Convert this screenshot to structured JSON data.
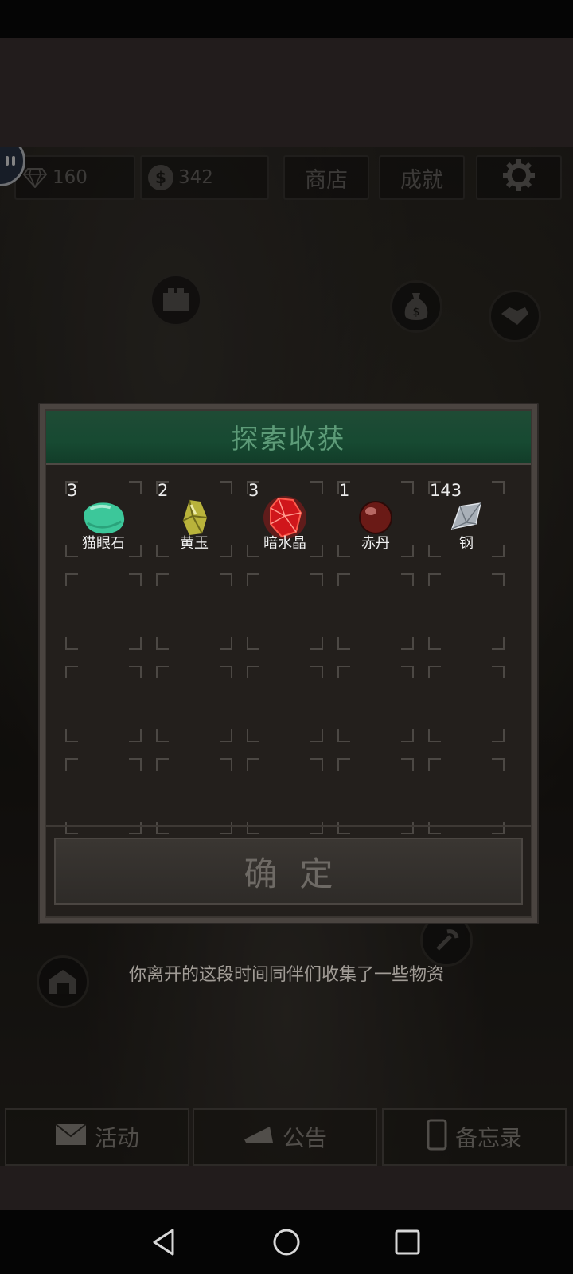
{
  "hud": {
    "gems": "160",
    "coins": "342",
    "coin_symbol": "$",
    "shop_label": "商店",
    "achievements_label": "成就"
  },
  "hint_text": "你离开的这段时间同伴们收集了一些物资",
  "tabs": [
    {
      "label": "活动",
      "icon": "mail-icon"
    },
    {
      "label": "公告",
      "icon": "megaphone-icon"
    },
    {
      "label": "备忘录",
      "icon": "phone-icon"
    }
  ],
  "dialog": {
    "title": "探索收获",
    "confirm_label": "确定",
    "items": [
      {
        "count": "3",
        "name": "猫眼石",
        "icon": "cats-eye-gem-icon",
        "color": "#3cc79a"
      },
      {
        "count": "2",
        "name": "黄玉",
        "icon": "topaz-gem-icon",
        "color": "#b9b33b"
      },
      {
        "count": "3",
        "name": "暗水晶",
        "icon": "dark-crystal-icon",
        "color": "#d0161b"
      },
      {
        "count": "1",
        "name": "赤丹",
        "icon": "red-pill-icon",
        "color": "#6a1a16"
      },
      {
        "count": "143",
        "name": "钢",
        "icon": "steel-icon",
        "color": "#a9b0b8"
      }
    ]
  }
}
